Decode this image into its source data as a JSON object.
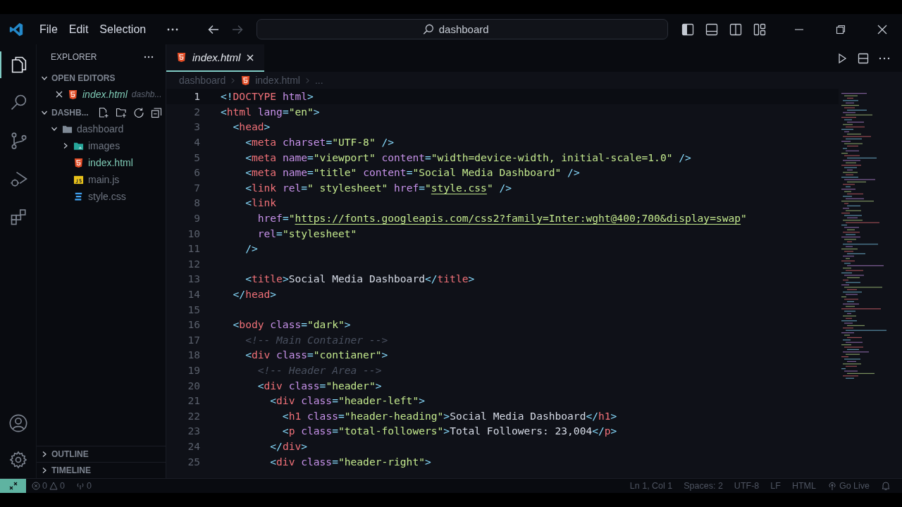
{
  "title_bar": {
    "menu": [
      {
        "label": "File"
      },
      {
        "label": "Edit"
      },
      {
        "label": "Selection"
      }
    ],
    "nav": [
      {
        "kind": "back",
        "disabled": false
      },
      {
        "kind": "forward",
        "disabled": true
      }
    ],
    "search": {
      "value": "dashboard"
    }
  },
  "activity_bar": {
    "items": [
      {
        "kind": "explorer",
        "selected": true
      },
      {
        "kind": "search",
        "selected": false
      },
      {
        "kind": "source-control",
        "selected": false
      },
      {
        "kind": "run-debug",
        "selected": false
      },
      {
        "kind": "extensions",
        "selected": false
      }
    ],
    "bottom": [
      {
        "kind": "account"
      },
      {
        "kind": "settings"
      }
    ]
  },
  "sidebar": {
    "title": "EXPLORER",
    "open_editors": {
      "label": "OPEN EDITORS",
      "expanded": true,
      "items": [
        {
          "name": "index.html",
          "kind": "html",
          "folder": "dashb...",
          "active": true
        }
      ]
    },
    "folder": {
      "label": "DASHB...",
      "expanded": true,
      "tree": [
        {
          "name": "dashboard",
          "kind": "folder",
          "expanded": true,
          "active": false,
          "children": [
            {
              "name": "images",
              "kind": "image-folder",
              "expanded": false,
              "active": false
            },
            {
              "name": "index.html",
              "kind": "html",
              "active": true
            },
            {
              "name": "main.js",
              "kind": "js",
              "active": false
            },
            {
              "name": "style.css",
              "kind": "css",
              "active": false
            }
          ]
        }
      ]
    },
    "bottom_sections": [
      {
        "label": "OUTLINE",
        "expanded": false
      },
      {
        "label": "TIMELINE",
        "expanded": false
      }
    ]
  },
  "editor": {
    "tabs": [
      {
        "label": "index.html",
        "kind": "html",
        "selected": true
      }
    ],
    "breadcrumbs": [
      {
        "label": "dashboard",
        "kind": "folder"
      },
      {
        "label": "index.html",
        "kind": "html"
      },
      {
        "label": "...",
        "kind": "more"
      }
    ],
    "lines": [
      {
        "number": "1",
        "current": true,
        "tokens": [
          {
            "kind": "punct",
            "text": "<!"
          },
          {
            "kind": "tag",
            "text": "DOCTYPE"
          },
          {
            "kind": "attr",
            "text": " html"
          },
          {
            "kind": "punct",
            "text": ">"
          }
        ]
      },
      {
        "number": "2",
        "current": false,
        "tokens": [
          {
            "kind": "punct",
            "text": "<"
          },
          {
            "kind": "tag",
            "text": "html"
          },
          {
            "kind": "attr",
            "text": " lang"
          },
          {
            "kind": "punct",
            "text": "="
          },
          {
            "kind": "string",
            "text": "\"en\""
          },
          {
            "kind": "punct",
            "text": ">"
          }
        ]
      },
      {
        "number": "3",
        "current": false,
        "tokens": [
          {
            "kind": "punct",
            "text": "  <"
          },
          {
            "kind": "tag",
            "text": "head"
          },
          {
            "kind": "punct",
            "text": ">"
          }
        ]
      },
      {
        "number": "4",
        "current": false,
        "tokens": [
          {
            "kind": "punct",
            "text": "    <"
          },
          {
            "kind": "tag",
            "text": "meta"
          },
          {
            "kind": "attr",
            "text": " charset"
          },
          {
            "kind": "punct",
            "text": "="
          },
          {
            "kind": "string",
            "text": "\"UTF-8\""
          },
          {
            "kind": "punct",
            "text": " />"
          }
        ]
      },
      {
        "number": "5",
        "current": false,
        "tokens": [
          {
            "kind": "punct",
            "text": "    <"
          },
          {
            "kind": "tag",
            "text": "meta"
          },
          {
            "kind": "attr",
            "text": " name"
          },
          {
            "kind": "punct",
            "text": "="
          },
          {
            "kind": "string",
            "text": "\"viewport\""
          },
          {
            "kind": "attr",
            "text": " content"
          },
          {
            "kind": "punct",
            "text": "="
          },
          {
            "kind": "string",
            "text": "\"width=device-width, initial-scale=1.0\""
          },
          {
            "kind": "punct",
            "text": " />"
          }
        ]
      },
      {
        "number": "6",
        "current": false,
        "tokens": [
          {
            "kind": "punct",
            "text": "    <"
          },
          {
            "kind": "tag",
            "text": "meta"
          },
          {
            "kind": "attr",
            "text": " name"
          },
          {
            "kind": "punct",
            "text": "="
          },
          {
            "kind": "string",
            "text": "\"title\""
          },
          {
            "kind": "attr",
            "text": " content"
          },
          {
            "kind": "punct",
            "text": "="
          },
          {
            "kind": "string",
            "text": "\"Social Media Dashboard\""
          },
          {
            "kind": "punct",
            "text": " />"
          }
        ]
      },
      {
        "number": "7",
        "current": false,
        "tokens": [
          {
            "kind": "punct",
            "text": "    <"
          },
          {
            "kind": "tag",
            "text": "link"
          },
          {
            "kind": "attr",
            "text": " rel"
          },
          {
            "kind": "punct",
            "text": "="
          },
          {
            "kind": "string",
            "text": "\" stylesheet\""
          },
          {
            "kind": "attr",
            "text": " href"
          },
          {
            "kind": "punct",
            "text": "="
          },
          {
            "kind": "string",
            "text": "\""
          },
          {
            "kind": "link",
            "text": "style.css"
          },
          {
            "kind": "string",
            "text": "\""
          },
          {
            "kind": "punct",
            "text": " />"
          }
        ]
      },
      {
        "number": "8",
        "current": false,
        "tokens": [
          {
            "kind": "punct",
            "text": "    <"
          },
          {
            "kind": "tag",
            "text": "link"
          }
        ]
      },
      {
        "number": "9",
        "current": false,
        "tokens": [
          {
            "kind": "attr",
            "text": "      href"
          },
          {
            "kind": "punct",
            "text": "="
          },
          {
            "kind": "string",
            "text": "\""
          },
          {
            "kind": "link",
            "text": "https://fonts.googleapis.com/css2?family=Inter:wght@400;700&display=swap"
          },
          {
            "kind": "string",
            "text": "\""
          }
        ]
      },
      {
        "number": "10",
        "current": false,
        "tokens": [
          {
            "kind": "attr",
            "text": "      rel"
          },
          {
            "kind": "punct",
            "text": "="
          },
          {
            "kind": "string",
            "text": "\"stylesheet\""
          }
        ]
      },
      {
        "number": "11",
        "current": false,
        "tokens": [
          {
            "kind": "punct",
            "text": "    />"
          }
        ]
      },
      {
        "number": "12",
        "current": false
      },
      {
        "number": "13",
        "current": false,
        "tokens": [
          {
            "kind": "punct",
            "text": "    <"
          },
          {
            "kind": "tag",
            "text": "title"
          },
          {
            "kind": "punct",
            "text": ">"
          },
          {
            "kind": "text",
            "text": "Social Media Dashboard"
          },
          {
            "kind": "punct",
            "text": "</"
          },
          {
            "kind": "tag",
            "text": "title"
          },
          {
            "kind": "punct",
            "text": ">"
          }
        ]
      },
      {
        "number": "14",
        "current": false,
        "tokens": [
          {
            "kind": "punct",
            "text": "  </"
          },
          {
            "kind": "tag",
            "text": "head"
          },
          {
            "kind": "punct",
            "text": ">"
          }
        ]
      },
      {
        "number": "15",
        "current": false
      },
      {
        "number": "16",
        "current": false,
        "tokens": [
          {
            "kind": "punct",
            "text": "  <"
          },
          {
            "kind": "tag",
            "text": "body"
          },
          {
            "kind": "attr",
            "text": " class"
          },
          {
            "kind": "punct",
            "text": "="
          },
          {
            "kind": "string",
            "text": "\"dark\""
          },
          {
            "kind": "punct",
            "text": ">"
          }
        ]
      },
      {
        "number": "17",
        "current": false,
        "tokens": [
          {
            "kind": "comment",
            "text": "    <!-- Main Container -->"
          }
        ]
      },
      {
        "number": "18",
        "current": false,
        "tokens": [
          {
            "kind": "punct",
            "text": "    <"
          },
          {
            "kind": "tag",
            "text": "div"
          },
          {
            "kind": "attr",
            "text": " class"
          },
          {
            "kind": "punct",
            "text": "="
          },
          {
            "kind": "string",
            "text": "\"contianer\""
          },
          {
            "kind": "punct",
            "text": ">"
          }
        ]
      },
      {
        "number": "19",
        "current": false,
        "tokens": [
          {
            "kind": "comment",
            "text": "      <!-- Header Area -->"
          }
        ]
      },
      {
        "number": "20",
        "current": false,
        "tokens": [
          {
            "kind": "punct",
            "text": "      <"
          },
          {
            "kind": "tag",
            "text": "div"
          },
          {
            "kind": "attr",
            "text": " class"
          },
          {
            "kind": "punct",
            "text": "="
          },
          {
            "kind": "string",
            "text": "\"header\""
          },
          {
            "kind": "punct",
            "text": ">"
          }
        ]
      },
      {
        "number": "21",
        "current": false,
        "tokens": [
          {
            "kind": "punct",
            "text": "        <"
          },
          {
            "kind": "tag",
            "text": "div"
          },
          {
            "kind": "attr",
            "text": " class"
          },
          {
            "kind": "punct",
            "text": "="
          },
          {
            "kind": "string",
            "text": "\"header-left\""
          },
          {
            "kind": "punct",
            "text": ">"
          }
        ]
      },
      {
        "number": "22",
        "current": false,
        "tokens": [
          {
            "kind": "punct",
            "text": "          <"
          },
          {
            "kind": "tag",
            "text": "h1"
          },
          {
            "kind": "attr",
            "text": " class"
          },
          {
            "kind": "punct",
            "text": "="
          },
          {
            "kind": "string",
            "text": "\"header-heading\""
          },
          {
            "kind": "punct",
            "text": ">"
          },
          {
            "kind": "text",
            "text": "Social Media Dashboard"
          },
          {
            "kind": "punct",
            "text": "</"
          },
          {
            "kind": "tag",
            "text": "h1"
          },
          {
            "kind": "punct",
            "text": ">"
          }
        ]
      },
      {
        "number": "23",
        "current": false,
        "tokens": [
          {
            "kind": "punct",
            "text": "          <"
          },
          {
            "kind": "tag",
            "text": "p"
          },
          {
            "kind": "attr",
            "text": " class"
          },
          {
            "kind": "punct",
            "text": "="
          },
          {
            "kind": "string",
            "text": "\"total-followers\""
          },
          {
            "kind": "punct",
            "text": ">"
          },
          {
            "kind": "text",
            "text": "Total Followers: 23,004"
          },
          {
            "kind": "punct",
            "text": "</"
          },
          {
            "kind": "tag",
            "text": "p"
          },
          {
            "kind": "punct",
            "text": ">"
          }
        ]
      },
      {
        "number": "24",
        "current": false,
        "tokens": [
          {
            "kind": "punct",
            "text": "        </"
          },
          {
            "kind": "tag",
            "text": "div"
          },
          {
            "kind": "punct",
            "text": ">"
          }
        ]
      },
      {
        "number": "25",
        "current": false,
        "tokens": [
          {
            "kind": "punct",
            "text": "        <"
          },
          {
            "kind": "tag",
            "text": "div"
          },
          {
            "kind": "attr",
            "text": " class"
          },
          {
            "kind": "punct",
            "text": "="
          },
          {
            "kind": "string",
            "text": "\"header-right\""
          },
          {
            "kind": "punct",
            "text": ">"
          }
        ]
      }
    ]
  },
  "status_bar": {
    "errors": "0",
    "warnings": "0",
    "ports": "0",
    "items": [
      "Ln 1, Col 1",
      "Spaces: 2",
      "UTF-8",
      "LF",
      "HTML"
    ],
    "go_live": "Go Live"
  }
}
